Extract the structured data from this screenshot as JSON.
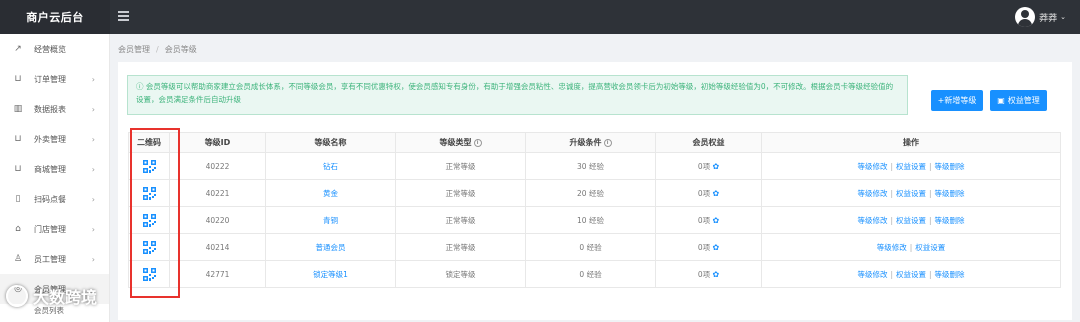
{
  "app": {
    "title": "商户云后台"
  },
  "user": {
    "name": "莽莽"
  },
  "sidebar": {
    "items": [
      {
        "label": "经营概览",
        "icon": "trend-icon",
        "glyph": "↗",
        "arrow": ""
      },
      {
        "label": "订单管理",
        "icon": "cart-icon",
        "glyph": "⊔",
        "arrow": "›"
      },
      {
        "label": "数据报表",
        "icon": "chart-icon",
        "glyph": "▥",
        "arrow": "›"
      },
      {
        "label": "外卖管理",
        "icon": "takeout-icon",
        "glyph": "⊔",
        "arrow": "›"
      },
      {
        "label": "商城管理",
        "icon": "shop-icon",
        "glyph": "⊔",
        "arrow": "›"
      },
      {
        "label": "扫码点餐",
        "icon": "scan-icon",
        "glyph": "▯",
        "arrow": "›"
      },
      {
        "label": "门店管理",
        "icon": "store-icon",
        "glyph": "⌂",
        "arrow": "›"
      },
      {
        "label": "员工管理",
        "icon": "staff-icon",
        "glyph": "♙",
        "arrow": "›"
      },
      {
        "label": "会员管理",
        "icon": "member-icon",
        "glyph": "◎",
        "arrow": ""
      }
    ],
    "sub_item": "会员列表"
  },
  "breadcrumb": {
    "root": "会员管理",
    "current": "会员等级"
  },
  "notice": "ⓘ 会员等级可以帮助商家建立会员成长体系，不同等级会员，享有不同优惠特权，使会员感知专有身份，有助于增强会员粘性、忠诚度，提高营收会员领卡后为初始等级，初始等级经验值为0，不可修改。根据会员卡等级经验值的设置，会员满足条件后自动升级",
  "buttons": {
    "add": "+新增等级",
    "rights": "权益管理"
  },
  "table": {
    "headers": [
      "二维码",
      "等级ID",
      "等级名称",
      "等级类型",
      "升级条件",
      "会员权益",
      "操作"
    ],
    "rows": [
      {
        "id": "40222",
        "name": "钻石",
        "type": "正常等级",
        "cond": "30 经验",
        "rights": "0项",
        "ops": [
          "等级修改",
          "权益设置",
          "等级删除"
        ]
      },
      {
        "id": "40221",
        "name": "黄金",
        "type": "正常等级",
        "cond": "20 经验",
        "rights": "0项",
        "ops": [
          "等级修改",
          "权益设置",
          "等级删除"
        ]
      },
      {
        "id": "40220",
        "name": "青铜",
        "type": "正常等级",
        "cond": "10 经验",
        "rights": "0项",
        "ops": [
          "等级修改",
          "权益设置",
          "等级删除"
        ]
      },
      {
        "id": "40214",
        "name": "普通会员",
        "type": "正常等级",
        "cond": "0 经验",
        "rights": "0项",
        "ops": [
          "等级修改",
          "权益设置"
        ]
      },
      {
        "id": "42771",
        "name": "锁定等级1",
        "type": "锁定等级",
        "cond": "0 经验",
        "rights": "0项",
        "ops": [
          "等级修改",
          "权益设置",
          "等级删除"
        ]
      }
    ]
  },
  "watermark": "大数跨境",
  "colors": {
    "accent": "#1890ff",
    "topbar": "#2e3238",
    "notice_text": "#3cb37b",
    "highlight": "#e8322d"
  }
}
